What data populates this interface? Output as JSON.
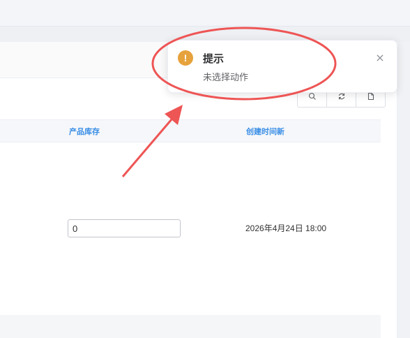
{
  "table": {
    "columns": [
      "产品库存",
      "创建时间新"
    ],
    "rows": [
      {
        "stock": "0",
        "created": "2026年4月24日 18:00"
      }
    ]
  },
  "toolbar": {
    "icons": [
      "search-icon",
      "refresh-icon",
      "export-icon"
    ]
  },
  "notification": {
    "icon_symbol": "!",
    "title": "提示",
    "message": "未选择动作",
    "close_symbol": "×",
    "type": "warning",
    "accent": "#e6a23c"
  },
  "annotation": {
    "color": "#ee5555"
  }
}
